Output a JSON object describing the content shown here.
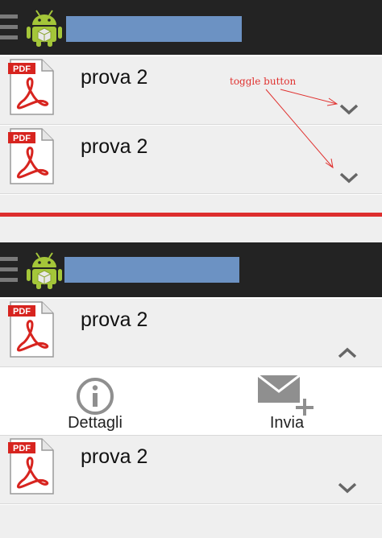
{
  "screens": [
    {
      "items": [
        {
          "file_type": "PDF",
          "name": "prova 2",
          "toggle_icon": "chevron-down"
        },
        {
          "file_type": "PDF",
          "name": "prova 2",
          "toggle_icon": "chevron-down"
        }
      ]
    },
    {
      "items": [
        {
          "file_type": "PDF",
          "name": "prova 2",
          "toggle_icon": "chevron-up"
        },
        {
          "file_type": "PDF",
          "name": "prova 2",
          "toggle_icon": "chevron-down"
        }
      ],
      "actions": {
        "details_label": "Dettagli",
        "send_label": "Invia"
      }
    }
  ],
  "annotation": {
    "text": "toggle button",
    "color": "#e0312f"
  },
  "colors": {
    "actionbar": "#232323",
    "title_placeholder": "#6c92c3",
    "row_background": "#efefef",
    "divider": "#dd2e2e",
    "pdf_red": "#d7241f",
    "android_green": "#a4c639"
  }
}
